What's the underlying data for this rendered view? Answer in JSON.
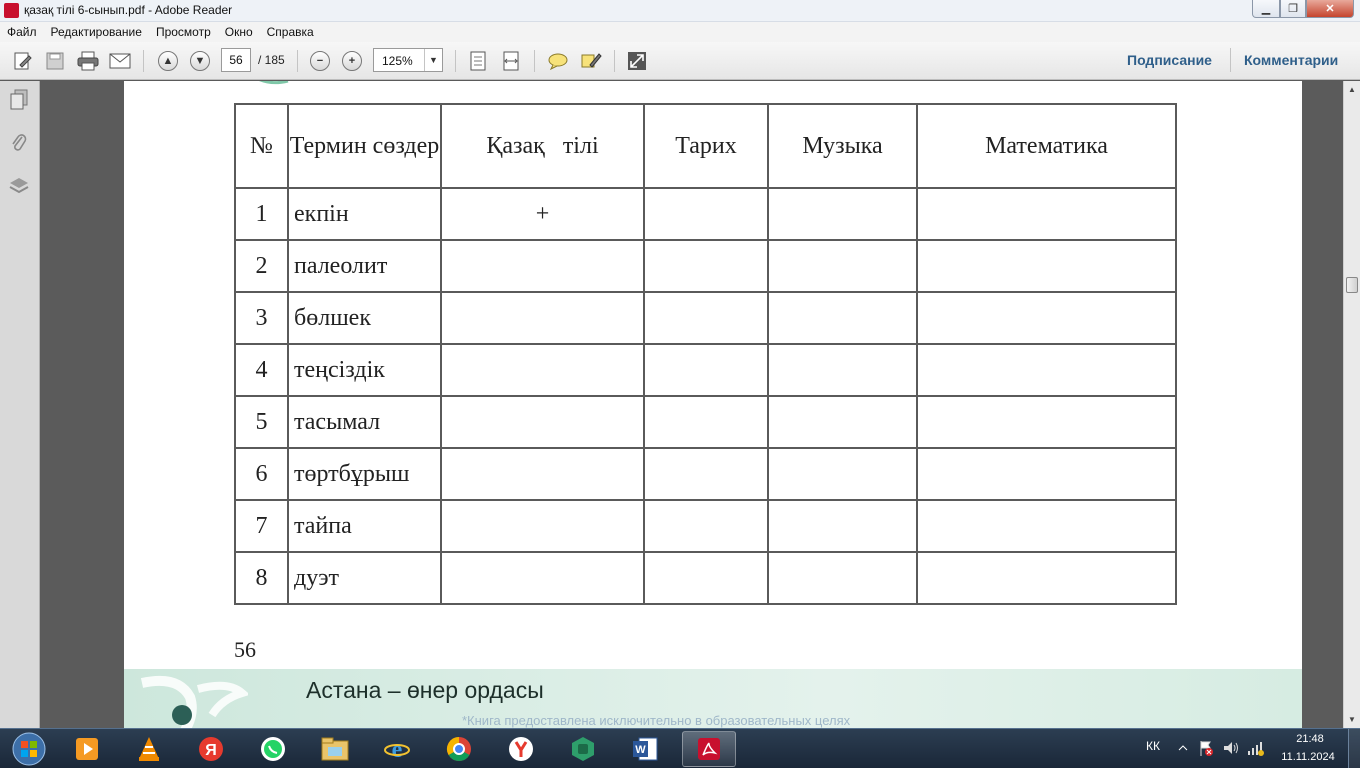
{
  "window": {
    "title": "қазақ тілі 6-сынып.pdf - Adobe Reader",
    "minimize_glyph": "▁",
    "maximize_glyph": "❐",
    "close_glyph": "✕"
  },
  "menu": {
    "items": [
      "Файл",
      "Редактирование",
      "Просмотр",
      "Окно",
      "Справка"
    ]
  },
  "toolbar": {
    "current_page": "56",
    "total_pages": "/ 185",
    "zoom": "125%",
    "sign_label": "Подписание",
    "comments_label": "Комментарии"
  },
  "document": {
    "table": {
      "headers": [
        "№",
        "Термин сөздер",
        "Қазақ   тілі",
        "Тарих",
        "Музыка",
        "Математика"
      ],
      "rows": [
        {
          "num": "1",
          "term": "екпін",
          "kazakh": "+",
          "history": "",
          "music": "",
          "math": ""
        },
        {
          "num": "2",
          "term": "палеолит",
          "kazakh": "",
          "history": "",
          "music": "",
          "math": ""
        },
        {
          "num": "3",
          "term": "бөлшек",
          "kazakh": "",
          "history": "",
          "music": "",
          "math": ""
        },
        {
          "num": "4",
          "term": "теңсіздік",
          "kazakh": "",
          "history": "",
          "music": "",
          "math": ""
        },
        {
          "num": "5",
          "term": "тасымал",
          "kazakh": "",
          "history": "",
          "music": "",
          "math": ""
        },
        {
          "num": "6",
          "term": "төртбұрыш",
          "kazakh": "",
          "history": "",
          "music": "",
          "math": ""
        },
        {
          "num": "7",
          "term": "тайпа",
          "kazakh": "",
          "history": "",
          "music": "",
          "math": ""
        },
        {
          "num": "8",
          "term": "дуэт",
          "kazakh": "",
          "history": "",
          "music": "",
          "math": ""
        }
      ]
    },
    "page_number": "56",
    "section_title": "Астана – өнер ордасы",
    "watermark_note": "*Книга предоставлена исключительно в образовательных целях"
  },
  "taskbar": {
    "language": "КК",
    "time": "21:48",
    "date": "11.11.2024"
  },
  "colors": {
    "link": "#2f5f8a",
    "footer_band": "#cde7dc",
    "taskbar": "#1f2d3f"
  }
}
